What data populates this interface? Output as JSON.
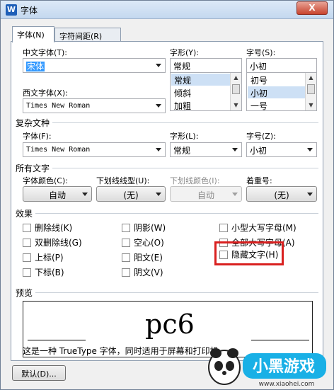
{
  "window": {
    "title": "字体",
    "close_label": "X",
    "icon_label": "W"
  },
  "tabs": [
    {
      "label": "字体(N)",
      "active": true
    },
    {
      "label": "字符间距(R)",
      "active": false
    }
  ],
  "chinese_font": {
    "label": "中文字体(T):",
    "value": "宋体"
  },
  "western_font": {
    "label": "西文字体(X):",
    "value": "Times New Roman"
  },
  "style": {
    "label": "字形(Y):",
    "value": "常规",
    "options": [
      "常规",
      "倾斜",
      "加粗"
    ],
    "selected": "常规"
  },
  "size": {
    "label": "字号(S):",
    "value": "小初",
    "options": [
      "初号",
      "小初",
      "一号"
    ],
    "selected": "小初"
  },
  "complex": {
    "group_label": "复杂文种",
    "font_label": "字体(F):",
    "font_value": "Times New Roman",
    "style_label": "字形(L):",
    "style_value": "常规",
    "size_label": "字号(Z):",
    "size_value": "小初"
  },
  "all_text": {
    "group_label": "所有文字",
    "color_label": "字体颜色(C):",
    "color_value": "自动",
    "underline_label": "下划线线型(U):",
    "underline_value": "(无)",
    "underline_color_label": "下划线颜色(I):",
    "underline_color_value": "自动",
    "emphasis_label": "着重号:",
    "emphasis_value": "(无)"
  },
  "effects": {
    "group_label": "效果",
    "items": [
      {
        "label": "删除线(K)",
        "checked": false
      },
      {
        "label": "双删除线(G)",
        "checked": false
      },
      {
        "label": "上标(P)",
        "checked": false
      },
      {
        "label": "下标(B)",
        "checked": false
      },
      {
        "label": "阴影(W)",
        "checked": false
      },
      {
        "label": "空心(O)",
        "checked": false
      },
      {
        "label": "阳文(E)",
        "checked": false
      },
      {
        "label": "阴文(V)",
        "checked": false
      },
      {
        "label": "小型大写字母(M)",
        "checked": false
      },
      {
        "label": "全部大写字母(A)",
        "checked": false
      },
      {
        "label": "隐藏文字(H)",
        "checked": false
      }
    ]
  },
  "preview": {
    "group_label": "预览",
    "sample_text": "pc6",
    "note": "这是一种 TrueType 字体，同时适用于屏幕和打印机。"
  },
  "footer": {
    "default_button": "默认(D)..."
  },
  "watermark": {
    "text": "小黑游戏",
    "url": "www.xiaohei.com"
  },
  "colors": {
    "highlight": "#d9201f",
    "selection": "#3399ff",
    "list_selected": "#cde0f5"
  }
}
